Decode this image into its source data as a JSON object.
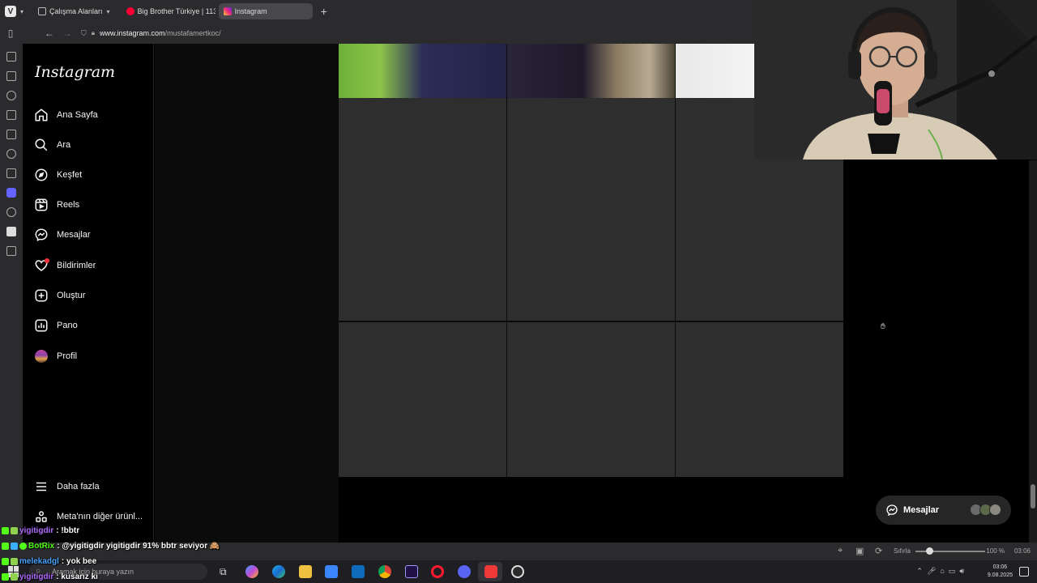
{
  "browser": {
    "tabs": [
      {
        "label": "Çalışma Alanları",
        "icon": "stack-icon"
      },
      {
        "label": "Big Brother Türkiye | 113. B",
        "icon": "youtube-icon"
      },
      {
        "label": "Instagram",
        "icon": "instagram-icon"
      }
    ],
    "url_host": "www.instagram.com",
    "url_path": "/mustafamertkoc/"
  },
  "instagram": {
    "logo": "Instagram",
    "nav": [
      {
        "label": "Ana Sayfa",
        "icon": "home-icon"
      },
      {
        "label": "Ara",
        "icon": "search-icon"
      },
      {
        "label": "Keşfet",
        "icon": "compass-icon"
      },
      {
        "label": "Reels",
        "icon": "reels-icon"
      },
      {
        "label": "Mesajlar",
        "icon": "messenger-icon"
      },
      {
        "label": "Bildirimler",
        "icon": "heart-icon"
      },
      {
        "label": "Oluştur",
        "icon": "plus-square-icon"
      },
      {
        "label": "Pano",
        "icon": "chart-icon"
      },
      {
        "label": "Profil",
        "icon": "avatar-icon"
      }
    ],
    "more": "Daha fazla",
    "meta": "Meta'nın diğer ürünl...",
    "messages_float": "Mesajlar"
  },
  "statusbar": {
    "zoom_label": "Sıfırla",
    "zoom": "100 %",
    "clock": "03:06"
  },
  "taskbar": {
    "search_placeholder": "Aramak için buraya yazın",
    "time": "03:06",
    "date": "9.08.2025"
  },
  "chat": [
    {
      "user": "yigitigdir",
      "user_color": "#b06bff",
      "message": ": !bbtr"
    },
    {
      "user": "BotRix",
      "user_color": "#53fc18",
      "message": ": @yigitigdir yigitigdir 91% bbtr seviyor 🙈"
    },
    {
      "user": "melekadgl",
      "user_color": "#4aa3ff",
      "message": ": yok bee"
    },
    {
      "user": "yigitigdir",
      "user_color": "#b06bff",
      "message": ": kusarız ki"
    }
  ],
  "colors": {
    "notification_dot": "#ff3040",
    "kick_green": "#53fc18"
  }
}
